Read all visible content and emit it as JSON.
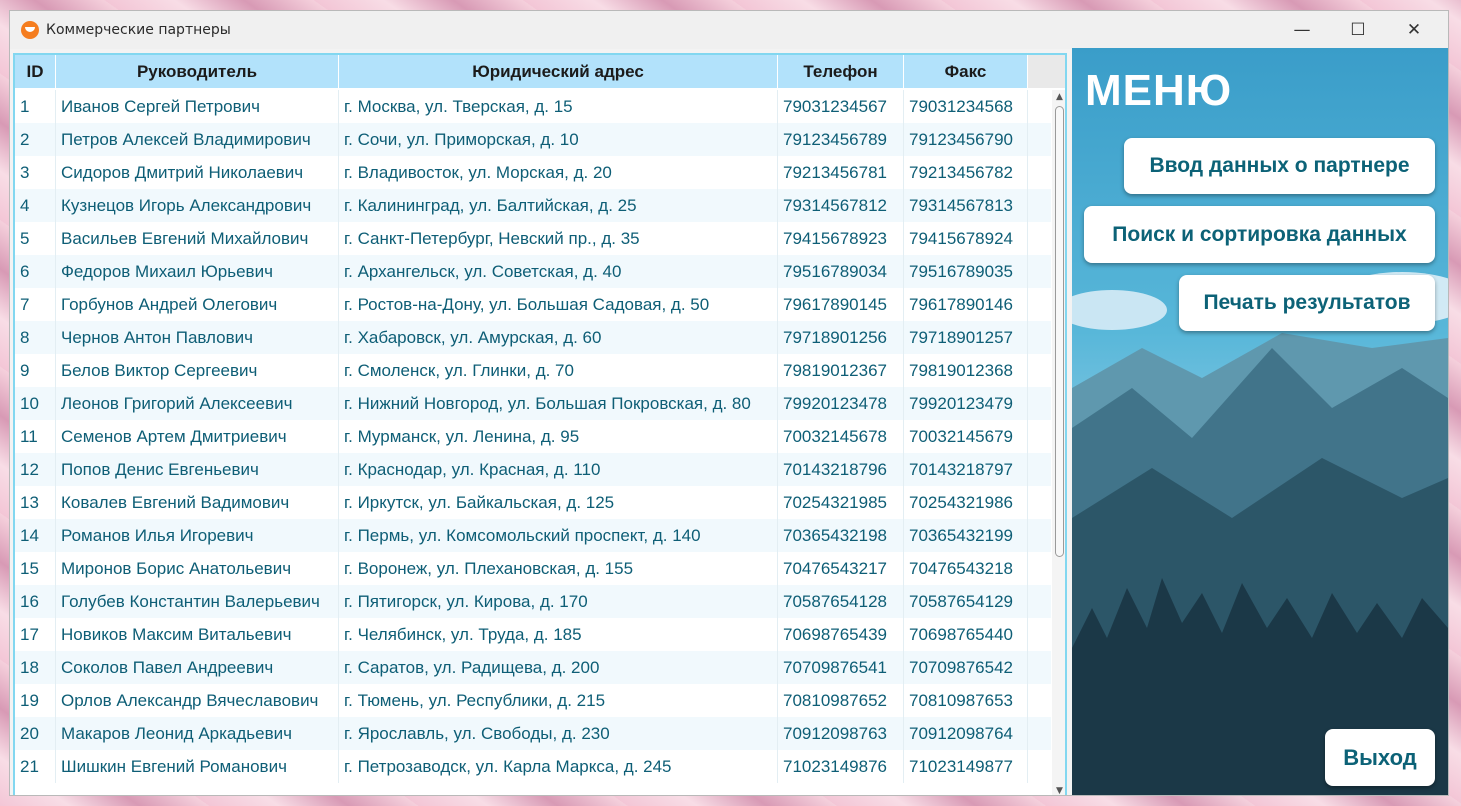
{
  "window": {
    "title": "Коммерческие партнеры"
  },
  "controls": {
    "minimize": "—",
    "maximize": "☐",
    "close": "✕"
  },
  "table": {
    "columns": [
      "ID",
      "Руководитель",
      "Юридический адрес",
      "Телефон",
      "Факс"
    ],
    "rows": [
      [
        "1",
        "Иванов Сергей Петрович",
        "г. Москва, ул. Тверская, д. 15",
        "79031234567",
        "79031234568"
      ],
      [
        "2",
        "Петров Алексей Владимирович",
        "г. Сочи, ул. Приморская, д. 10",
        "79123456789",
        "79123456790"
      ],
      [
        "3",
        "Сидоров Дмитрий Николаевич",
        "г. Владивосток, ул. Морская, д. 20",
        "79213456781",
        "79213456782"
      ],
      [
        "4",
        "Кузнецов Игорь Александрович",
        "г. Калининград, ул. Балтийская, д. 25",
        "79314567812",
        "79314567813"
      ],
      [
        "5",
        "Васильев Евгений Михайлович",
        "г. Санкт-Петербург, Невский пр., д. 35",
        "79415678923",
        "79415678924"
      ],
      [
        "6",
        "Федоров Михаил Юрьевич",
        "г. Архангельск, ул. Советская, д. 40",
        "79516789034",
        "79516789035"
      ],
      [
        "7",
        "Горбунов Андрей Олегович",
        "г. Ростов-на-Дону, ул. Большая Садовая, д. 50",
        "79617890145",
        "79617890146"
      ],
      [
        "8",
        "Чернов Антон Павлович",
        "г. Хабаровск, ул. Амурская, д. 60",
        "79718901256",
        "79718901257"
      ],
      [
        "9",
        "Белов Виктор Сергеевич",
        "г. Смоленск, ул. Глинки, д. 70",
        "79819012367",
        "79819012368"
      ],
      [
        "10",
        "Леонов Григорий Алексеевич",
        "г. Нижний Новгород, ул. Большая Покровская, д. 80",
        "79920123478",
        "79920123479"
      ],
      [
        "11",
        "Семенов Артем Дмитриевич",
        "г. Мурманск, ул. Ленина, д. 95",
        "70032145678",
        "70032145679"
      ],
      [
        "12",
        "Попов Денис Евгеньевич",
        "г. Краснодар, ул. Красная, д. 110",
        "70143218796",
        "70143218797"
      ],
      [
        "13",
        "Ковалев Евгений Вадимович",
        "г. Иркутск, ул. Байкальская, д. 125",
        "70254321985",
        "70254321986"
      ],
      [
        "14",
        "Романов Илья Игоревич",
        "г. Пермь, ул. Комсомольский проспект, д. 140",
        "70365432198",
        "70365432199"
      ],
      [
        "15",
        "Миронов Борис Анатольевич",
        "г. Воронеж, ул. Плехановская, д. 155",
        "70476543217",
        "70476543218"
      ],
      [
        "16",
        "Голубев Константин Валерьевич",
        "г. Пятигорск, ул. Кирова, д. 170",
        "70587654128",
        "70587654129"
      ],
      [
        "17",
        "Новиков Максим Витальевич",
        "г. Челябинск, ул. Труда, д. 185",
        "70698765439",
        "70698765440"
      ],
      [
        "18",
        "Соколов Павел Андреевич",
        "г. Саратов, ул. Радищева, д. 200",
        "70709876541",
        "70709876542"
      ],
      [
        "19",
        "Орлов Александр Вячеславович",
        "г. Тюмень, ул. Республики, д. 215",
        "70810987652",
        "70810987653"
      ],
      [
        "20",
        "Макаров Леонид Аркадьевич",
        "г. Ярославль, ул. Свободы, д. 230",
        "70912098763",
        "70912098764"
      ],
      [
        "21",
        "Шишкин Евгений Романович",
        "г. Петрозаводск, ул. Карла Маркса, д. 245",
        "71023149876",
        "71023149877"
      ]
    ]
  },
  "menu": {
    "title": "МЕНЮ",
    "input_button": "Ввод данных о партнере",
    "search_button": "Поиск и сортировка данных",
    "print_button": "Печать результатов",
    "exit_button": "Выход"
  },
  "colors": {
    "header_bg": "#b2e2fb",
    "cell_text": "#0e5e76",
    "grid_border": "#82d7f0",
    "button_text": "#0c6277"
  }
}
